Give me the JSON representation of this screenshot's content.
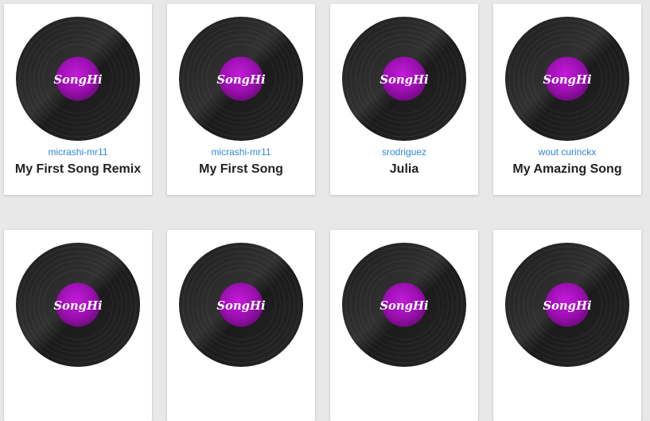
{
  "brand": {
    "logo_text": "SongHi",
    "record_color": "#1b1b1b",
    "label_color": "#9b0fb0",
    "link_color": "#2f88d8"
  },
  "songs": [
    {
      "author": "micrashi-mr11",
      "title": "My First Song Remix"
    },
    {
      "author": "micrashi-mr11",
      "title": "My First Song"
    },
    {
      "author": "srodriguez",
      "title": "Julia"
    },
    {
      "author": "wout curinckx",
      "title": "My Amazing Song"
    },
    {
      "author": "",
      "title": ""
    },
    {
      "author": "",
      "title": ""
    },
    {
      "author": "",
      "title": ""
    },
    {
      "author": "",
      "title": ""
    }
  ]
}
